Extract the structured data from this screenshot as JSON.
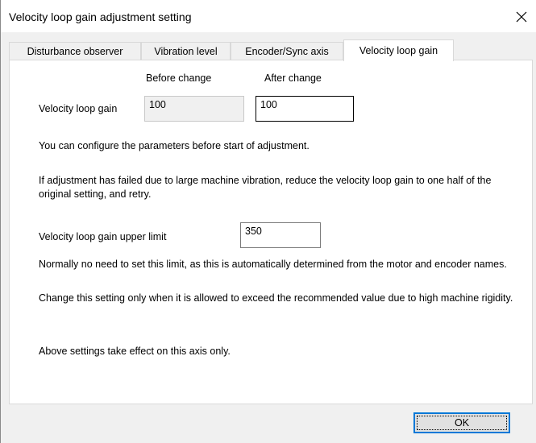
{
  "window": {
    "title": "Velocity loop gain adjustment setting"
  },
  "tabs": [
    {
      "label": "Disturbance observer"
    },
    {
      "label": "Vibration level"
    },
    {
      "label": "Encoder/Sync axis"
    },
    {
      "label": "Velocity loop gain"
    }
  ],
  "panel": {
    "before_header": "Before change",
    "after_header": "After change",
    "gain_label": "Velocity loop gain",
    "gain_before": "100",
    "gain_after": "100",
    "note_configure": "You can configure the parameters before start of adjustment.",
    "note_failed": "If adjustment has failed due to large machine vibration, reduce the velocity loop gain to one half of the original setting, and retry.",
    "upper_label": "Velocity loop gain upper limit",
    "upper_value": "350",
    "note_normally": "Normally no need to set this limit, as this is automatically determined from the motor and encoder names.",
    "note_change": "Change this setting only when it is allowed to exceed the recommended value due to high machine rigidity.",
    "note_axis": "Above settings take effect on this axis only."
  },
  "buttons": {
    "ok": "OK"
  }
}
